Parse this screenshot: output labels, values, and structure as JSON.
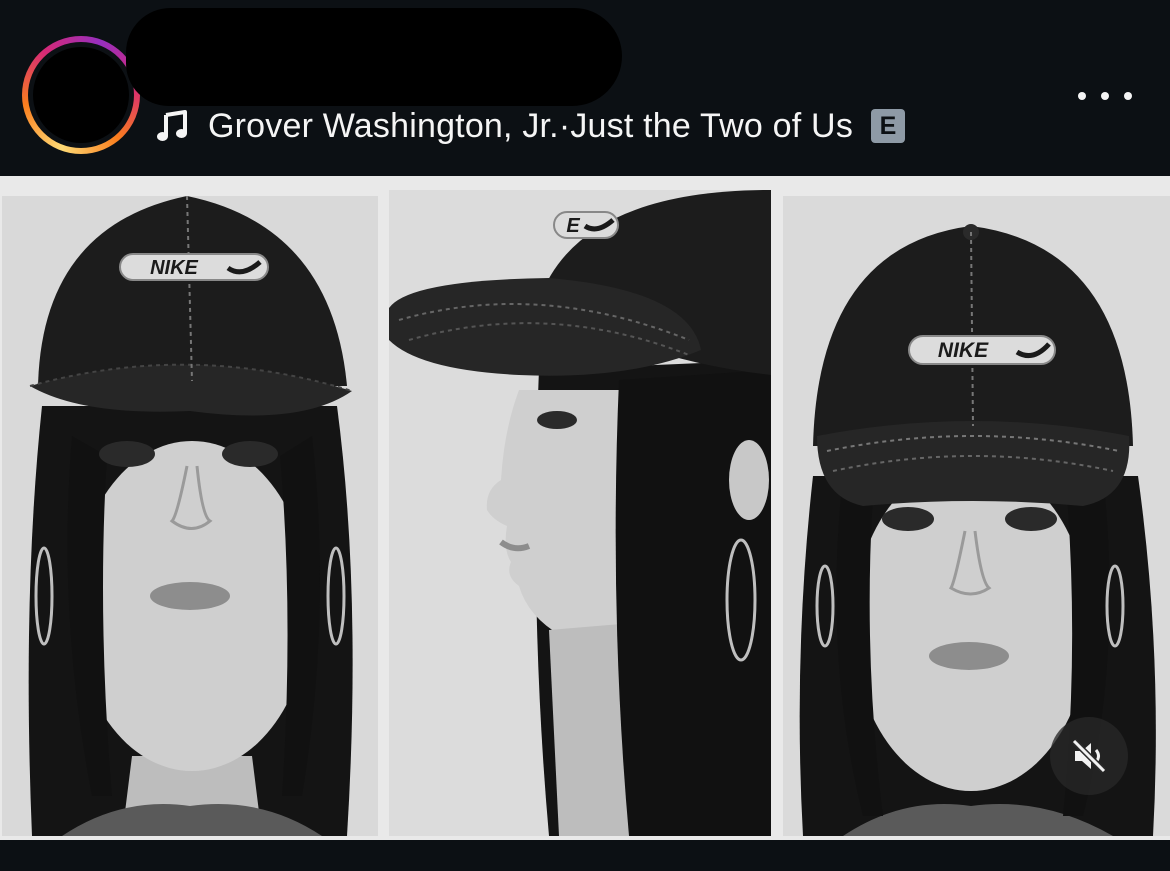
{
  "post": {
    "music": {
      "artist": "Grover Washington, Jr.",
      "separator": " · ",
      "title": "Just the Two of Us",
      "explicit_badge": "E",
      "icon": "music-note-icon"
    },
    "more_icon": "more-horizontal-icon",
    "mute_icon": "speaker-muted-icon"
  },
  "photos": [
    {
      "cap_logo": "NIKE"
    },
    {
      "cap_logo": "E"
    },
    {
      "cap_logo": "NIKE"
    }
  ],
  "colors": {
    "background": "#0c1014",
    "text": "#f5f5f5",
    "badge": "#8e9aa6",
    "photo_background": "#e9e9e9"
  }
}
